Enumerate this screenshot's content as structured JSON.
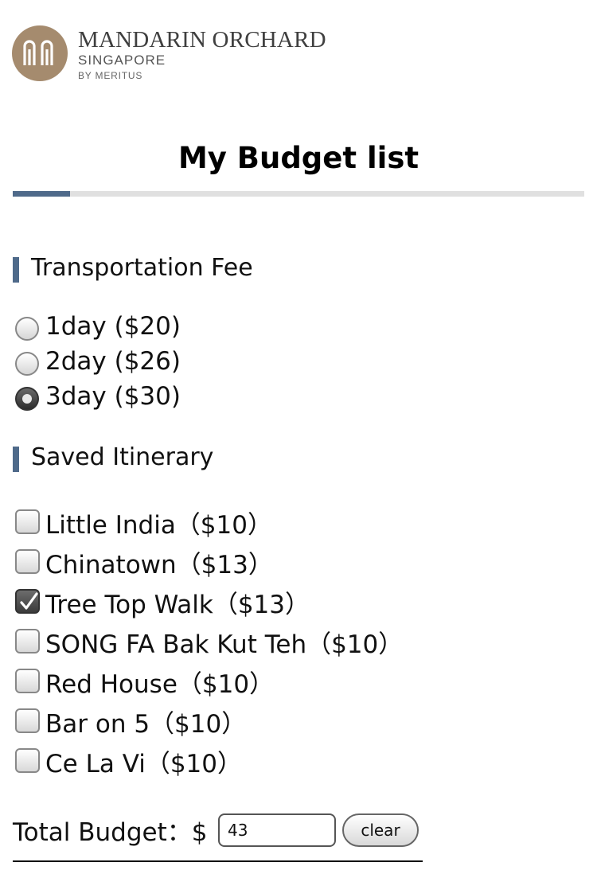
{
  "brand": {
    "name": "MANDARIN ORCHARD",
    "city": "SINGAPORE",
    "byline": "BY MERITUS",
    "logo_color": "#a58b6e"
  },
  "page": {
    "title": "My Budget list",
    "accent_color": "#4f6a8a"
  },
  "transportation": {
    "heading": "Transportation Fee",
    "options": [
      {
        "label": "1day ($20)",
        "selected": false
      },
      {
        "label": "2day ($26)",
        "selected": false
      },
      {
        "label": "3day ($30)",
        "selected": true
      }
    ]
  },
  "itinerary": {
    "heading": "Saved Itinerary",
    "items": [
      {
        "label": " Little India（$10）",
        "checked": false
      },
      {
        "label": " Chinatown（$13）",
        "checked": false
      },
      {
        "label": "Tree Top Walk（$13）",
        "checked": true
      },
      {
        "label": "SONG FA Bak Kut Teh（$10）",
        "checked": false
      },
      {
        "label": "Red House（$10）",
        "checked": false
      },
      {
        "label": "Bar on 5（$10）",
        "checked": false
      },
      {
        "label": "Ce La Vi（$10）",
        "checked": false
      }
    ]
  },
  "total": {
    "label": "Total Budget：$",
    "value": "43",
    "clear_label": "clear"
  }
}
